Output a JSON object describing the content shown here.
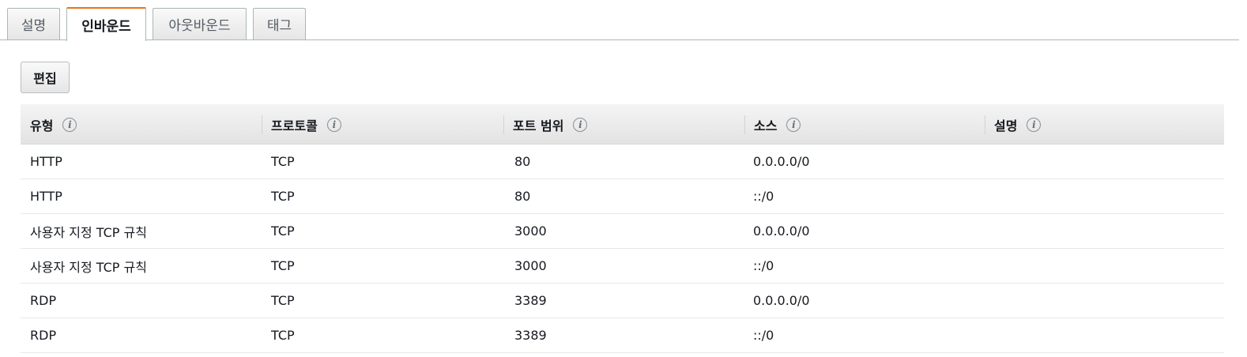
{
  "tabs": [
    {
      "label": "설명",
      "active": false
    },
    {
      "label": "인바운드",
      "active": true
    },
    {
      "label": "아웃바운드",
      "active": false
    },
    {
      "label": "태그",
      "active": false
    }
  ],
  "toolbar": {
    "edit_label": "편집"
  },
  "table": {
    "columns": [
      "유형",
      "프로토콜",
      "포트 범위",
      "소스",
      "설명"
    ],
    "rows": [
      {
        "type": "HTTP",
        "protocol": "TCP",
        "port": "80",
        "source": "0.0.0.0/0",
        "description": ""
      },
      {
        "type": "HTTP",
        "protocol": "TCP",
        "port": "80",
        "source": "::/0",
        "description": ""
      },
      {
        "type": "사용자 지정 TCP 규칙",
        "protocol": "TCP",
        "port": "3000",
        "source": "0.0.0.0/0",
        "description": ""
      },
      {
        "type": "사용자 지정 TCP 규칙",
        "protocol": "TCP",
        "port": "3000",
        "source": "::/0",
        "description": ""
      },
      {
        "type": "RDP",
        "protocol": "TCP",
        "port": "3389",
        "source": "0.0.0.0/0",
        "description": ""
      },
      {
        "type": "RDP",
        "protocol": "TCP",
        "port": "3389",
        "source": "::/0",
        "description": ""
      }
    ]
  },
  "icons": {
    "info": "i"
  },
  "colors": {
    "active_tab_accent": "#ec7211"
  }
}
